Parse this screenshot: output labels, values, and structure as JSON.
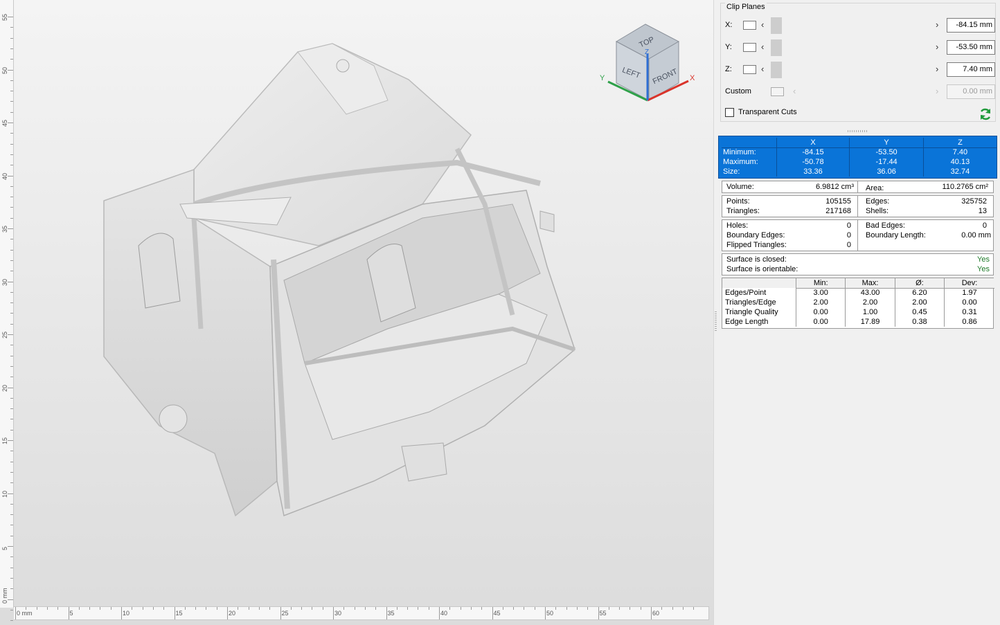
{
  "viewport": {
    "ruler_v_labels": [
      "55",
      "50",
      "45",
      "40",
      "35",
      "30",
      "25",
      "20",
      "15",
      "10",
      "5",
      "0 mm"
    ],
    "ruler_h_labels": [
      "0 mm",
      "5",
      "10",
      "15",
      "20",
      "25",
      "30",
      "35",
      "40",
      "45",
      "50",
      "55",
      "60"
    ],
    "viewcube": {
      "top": "TOP",
      "left": "LEFT",
      "front": "FRONT",
      "axis_x": "X",
      "axis_y": "Y",
      "axis_z": "Z"
    }
  },
  "clip_planes": {
    "title": "Clip Planes",
    "rows": [
      {
        "label": "X:",
        "value": "-84.15 mm"
      },
      {
        "label": "Y:",
        "value": "-53.50 mm"
      },
      {
        "label": "Z:",
        "value": "7.40 mm"
      },
      {
        "label": "Custom",
        "value": "0.00 mm"
      }
    ],
    "transparent_cuts": "Transparent Cuts"
  },
  "bounding_box": {
    "headers": [
      "X",
      "Y",
      "Z"
    ],
    "rows": [
      {
        "label": "Minimum:",
        "values": [
          "-84.15",
          "-53.50",
          "7.40"
        ]
      },
      {
        "label": "Maximum:",
        "values": [
          "-50.78",
          "-17.44",
          "40.13"
        ]
      },
      {
        "label": "Size:",
        "values": [
          "33.36",
          "36.06",
          "32.74"
        ]
      }
    ]
  },
  "volume": {
    "label": "Volume:",
    "value": "6.9812 cm³",
    "area_label": "Area:",
    "area_value": "110.2765 cm²"
  },
  "counts": {
    "points_label": "Points:",
    "points": "105155",
    "triangles_label": "Triangles:",
    "triangles": "217168",
    "edges_label": "Edges:",
    "edges": "325752",
    "shells_label": "Shells:",
    "shells": "13"
  },
  "errors": {
    "holes_label": "Holes:",
    "holes": "0",
    "boundary_edges_label": "Boundary Edges:",
    "boundary_edges": "0",
    "flipped_label": "Flipped Triangles:",
    "flipped": "0",
    "bad_edges_label": "Bad Edges:",
    "bad_edges": "0",
    "boundary_length_label": "Boundary Length:",
    "boundary_length": "0.00 mm"
  },
  "surface": {
    "closed_label": "Surface is closed:",
    "closed": "Yes",
    "orientable_label": "Surface is orientable:",
    "orientable": "Yes"
  },
  "stats": {
    "headers": [
      "Min:",
      "Max:",
      "Ø:",
      "Dev:"
    ],
    "rows": [
      {
        "label": "Edges/Point",
        "values": [
          "3.00",
          "43.00",
          "6.20",
          "1.97"
        ]
      },
      {
        "label": "Triangles/Edge",
        "values": [
          "2.00",
          "2.00",
          "2.00",
          "0.00"
        ]
      },
      {
        "label": "Triangle Quality",
        "values": [
          "0.00",
          "1.00",
          "0.45",
          "0.31"
        ]
      },
      {
        "label": "Edge Length",
        "values": [
          "0.00",
          "17.89",
          "0.38",
          "0.86"
        ]
      }
    ]
  }
}
